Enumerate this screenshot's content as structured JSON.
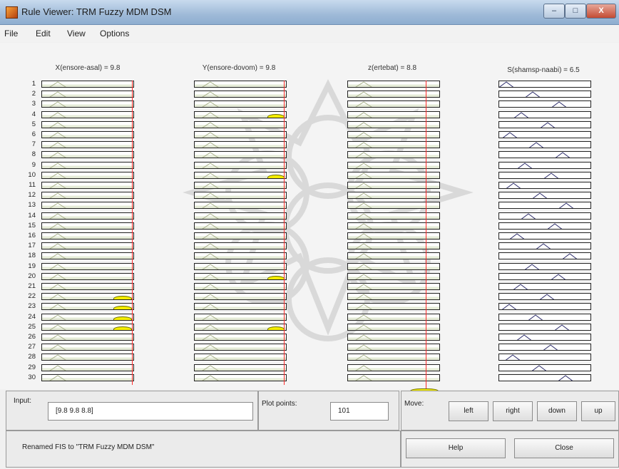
{
  "window": {
    "title": "Rule Viewer: TRM Fuzzy MDM DSM"
  },
  "window_controls": {
    "minimize": "–",
    "maximize": "□",
    "close": "X"
  },
  "menu": [
    "File",
    "Edit",
    "View",
    "Options"
  ],
  "variables": [
    {
      "label": "X(ensore-asal) = 9.8"
    },
    {
      "label": "Y(ensore-dovom) = 9.8"
    },
    {
      "label": "z(ertebat) = 8.8"
    },
    {
      "label": "S(shamsp-naabi) = 6.5"
    }
  ],
  "rules": [
    "1",
    "2",
    "3",
    "4",
    "5",
    "6",
    "7",
    "8",
    "9",
    "10",
    "11",
    "12",
    "13",
    "14",
    "15",
    "16",
    "17",
    "18",
    "19",
    "20",
    "21",
    "22",
    "23",
    "24",
    "25",
    "26",
    "27",
    "28",
    "29",
    "30"
  ],
  "input_panel": {
    "label": "Input:",
    "value": "[9.8 9.8 8.8]"
  },
  "plot_points_panel": {
    "label": "Plot points:",
    "value": "101"
  },
  "move_panel": {
    "label": "Move:",
    "buttons": [
      "left",
      "right",
      "down",
      "up"
    ]
  },
  "status_panel": {
    "message": "Renamed FIS to \"TRM Fuzzy MDM DSM\""
  },
  "actions": {
    "help": "Help",
    "close": "Close"
  },
  "colors": {
    "firing_fill": "#f5ee00",
    "input_line": "#ff2a2a",
    "outline": "#222222"
  }
}
